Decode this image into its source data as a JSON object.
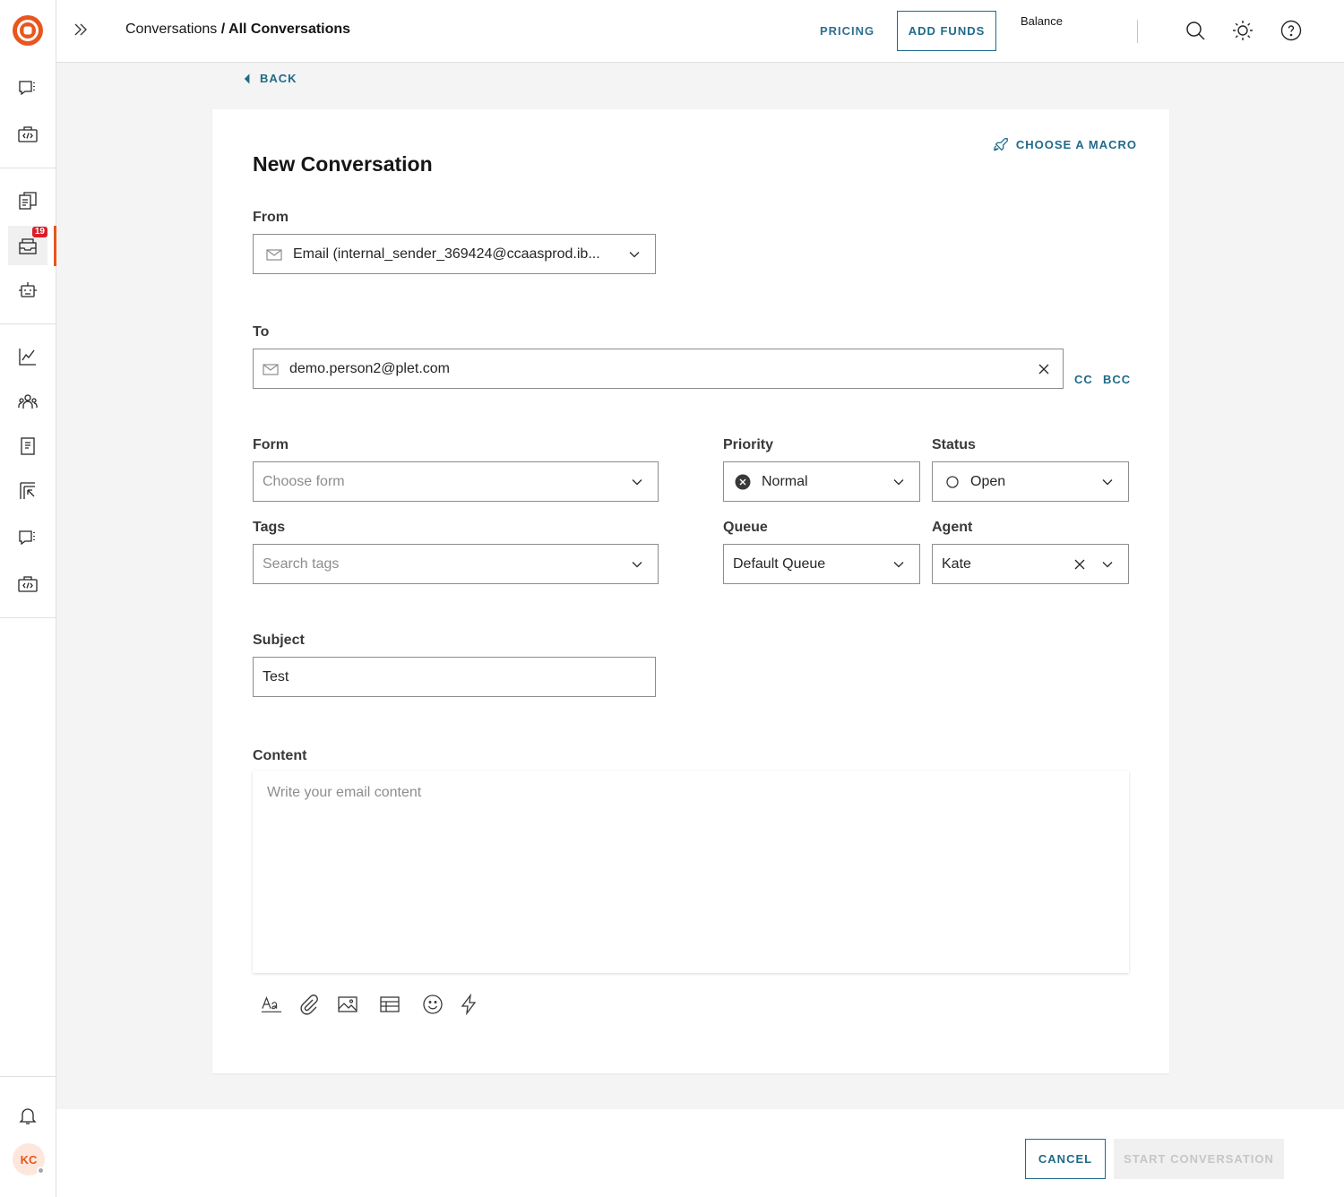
{
  "topbar": {
    "breadcrumb_parent": "Conversations",
    "breadcrumb_sep": " / ",
    "breadcrumb_current": "All Conversations",
    "pricing_label": "PRICING",
    "add_funds_label": "ADD FUNDS",
    "balance_label": "Balance"
  },
  "sidebar": {
    "badge_count": "19",
    "avatar_initials": "KC",
    "accent_color": "#e8561d"
  },
  "back_label": "BACK",
  "form": {
    "title": "New Conversation",
    "macro_label": "CHOOSE A MACRO",
    "from": {
      "label": "From",
      "value": "Email (internal_sender_369424@ccaasprod.ib..."
    },
    "to": {
      "label": "To",
      "value": "demo.person2@plet.com",
      "cc_label": "CC",
      "bcc_label": "BCC"
    },
    "form_select": {
      "label": "Form",
      "placeholder": "Choose form"
    },
    "priority": {
      "label": "Priority",
      "value": "Normal"
    },
    "status": {
      "label": "Status",
      "value": "Open"
    },
    "tags": {
      "label": "Tags",
      "placeholder": "Search tags"
    },
    "queue": {
      "label": "Queue",
      "value": "Default Queue"
    },
    "agent": {
      "label": "Agent",
      "value": "Kate"
    },
    "subject": {
      "label": "Subject",
      "value": "Test"
    },
    "content": {
      "label": "Content",
      "placeholder": "Write your email content"
    }
  },
  "footer": {
    "cancel_label": "CANCEL",
    "start_label": "START CONVERSATION"
  }
}
